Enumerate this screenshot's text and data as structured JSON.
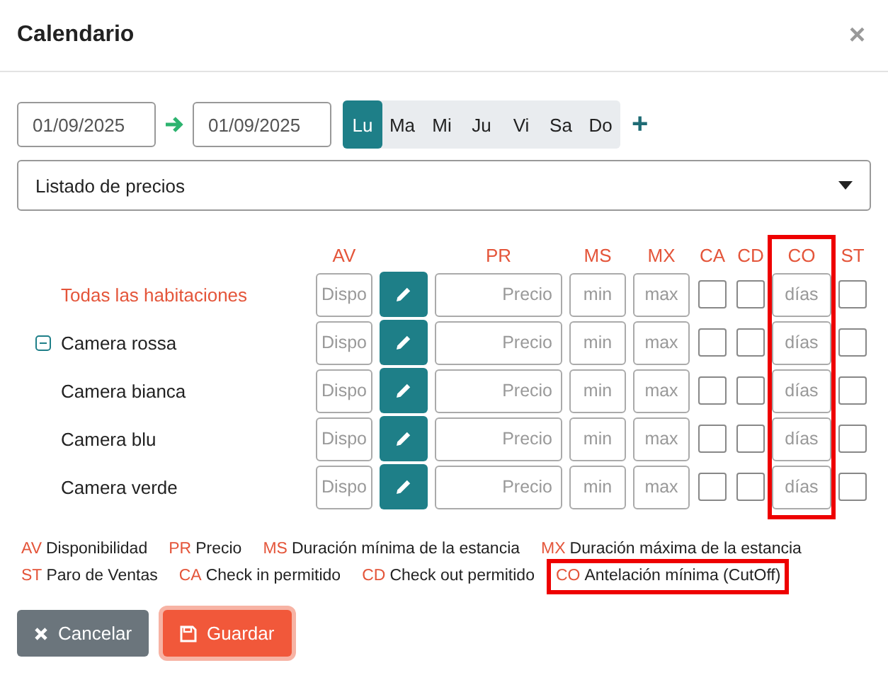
{
  "window": {
    "title": "Calendario",
    "close": "×"
  },
  "date_range": {
    "from": "01/09/2025",
    "to": "01/09/2025"
  },
  "weekdays": [
    {
      "label": "Lu",
      "selected": true
    },
    {
      "label": "Ma",
      "selected": false
    },
    {
      "label": "Mi",
      "selected": false
    },
    {
      "label": "Ju",
      "selected": false
    },
    {
      "label": "Vi",
      "selected": false
    },
    {
      "label": "Sa",
      "selected": false
    },
    {
      "label": "Do",
      "selected": false
    }
  ],
  "add_label": "+",
  "list_select": {
    "value": "Listado de precios"
  },
  "columns": [
    {
      "label": "AV",
      "kind": "input"
    },
    {
      "kind": "edit"
    },
    {
      "label": "PR",
      "kind": "price"
    },
    {
      "label": "MS",
      "kind": "input"
    },
    {
      "label": "MX",
      "kind": "input"
    },
    {
      "label": "CA",
      "kind": "checkbox"
    },
    {
      "label": "CD",
      "kind": "checkbox"
    },
    {
      "label": "CO",
      "kind": "input",
      "highlighted": true
    },
    {
      "label": "ST",
      "kind": "checkbox"
    }
  ],
  "all_rooms": {
    "name": "Todas las habitaciones",
    "placeholders": [
      "Dispo",
      "Precio",
      "min",
      "max",
      "días"
    ],
    "checked": [
      false,
      false,
      false
    ]
  },
  "rooms": [
    {
      "name": "Camera rossa",
      "expanded": true,
      "placeholders": [
        "Dispo",
        "Precio",
        "min",
        "max",
        "días"
      ],
      "checked": [
        false,
        false,
        false
      ],
      "children": [
        {
          "name": "Camera bianca",
          "placeholders": [
            "Dispo",
            "Precio",
            "min",
            "max",
            "días"
          ],
          "checked": [
            false,
            false,
            false
          ]
        },
        {
          "name": "Camera blu",
          "placeholders": [
            "Dispo",
            "Precio",
            "min",
            "max",
            "días"
          ],
          "checked": [
            false,
            false,
            false
          ]
        },
        {
          "name": "Camera verde",
          "placeholders": [
            "Dispo",
            "Precio",
            "min",
            "max",
            "días"
          ],
          "checked": [
            false,
            false,
            false
          ]
        }
      ]
    }
  ],
  "legend": [
    {
      "code": "AV",
      "text": "Disponibilidad"
    },
    {
      "code": "PR",
      "text": "Precio"
    },
    {
      "code": "MS",
      "text": "Duración mínima de la estancia"
    },
    {
      "code": "MX",
      "text": "Duración máxima de la estancia"
    },
    {
      "code": "ST",
      "text": "Paro de Ventas"
    },
    {
      "code": "CA",
      "text": "Check in permitido"
    },
    {
      "code": "CD",
      "text": "Check out permitido"
    },
    {
      "code": "CO",
      "text": "Antelación mínima (CutOff)",
      "highlighted": true
    }
  ],
  "buttons": [
    {
      "label": "Cancelar",
      "kind": "cancel",
      "focused": false
    },
    {
      "label": "Guardar",
      "kind": "save",
      "focused": true
    }
  ]
}
